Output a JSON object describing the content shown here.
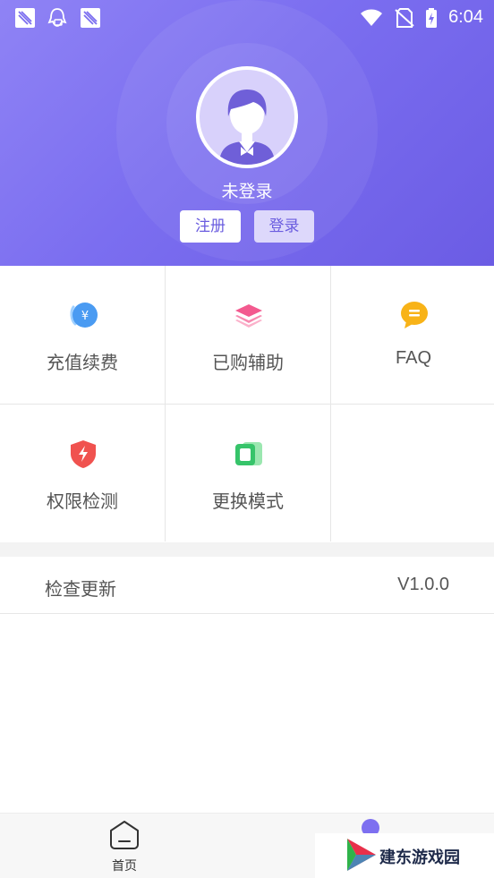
{
  "status_bar": {
    "time": "6:04",
    "left_icons": [
      "notification-icon",
      "qq-icon",
      "notification-icon"
    ],
    "right_icons": [
      "wifi-icon",
      "no-sim-icon",
      "battery-charging-icon"
    ]
  },
  "profile": {
    "status_text": "未登录",
    "register_label": "注册",
    "login_label": "登录",
    "avatar_icon": "user-avatar-icon"
  },
  "grid": {
    "items": [
      {
        "label": "充值续费",
        "icon": "recharge-icon"
      },
      {
        "label": "已购辅助",
        "icon": "layers-icon"
      },
      {
        "label": "FAQ",
        "icon": "chat-bubble-icon"
      },
      {
        "label": "权限检测",
        "icon": "shield-icon"
      },
      {
        "label": "更换模式",
        "icon": "switch-mode-icon"
      }
    ]
  },
  "update": {
    "label": "检查更新",
    "version": "V1.0.0"
  },
  "bottom_nav": {
    "home_label": "首页"
  },
  "watermark": {
    "text": "建东游戏园"
  },
  "colors": {
    "header_gradient_start": "#8f83f5",
    "header_gradient_end": "#6b5ce4",
    "accent": "#6a5cdf"
  }
}
